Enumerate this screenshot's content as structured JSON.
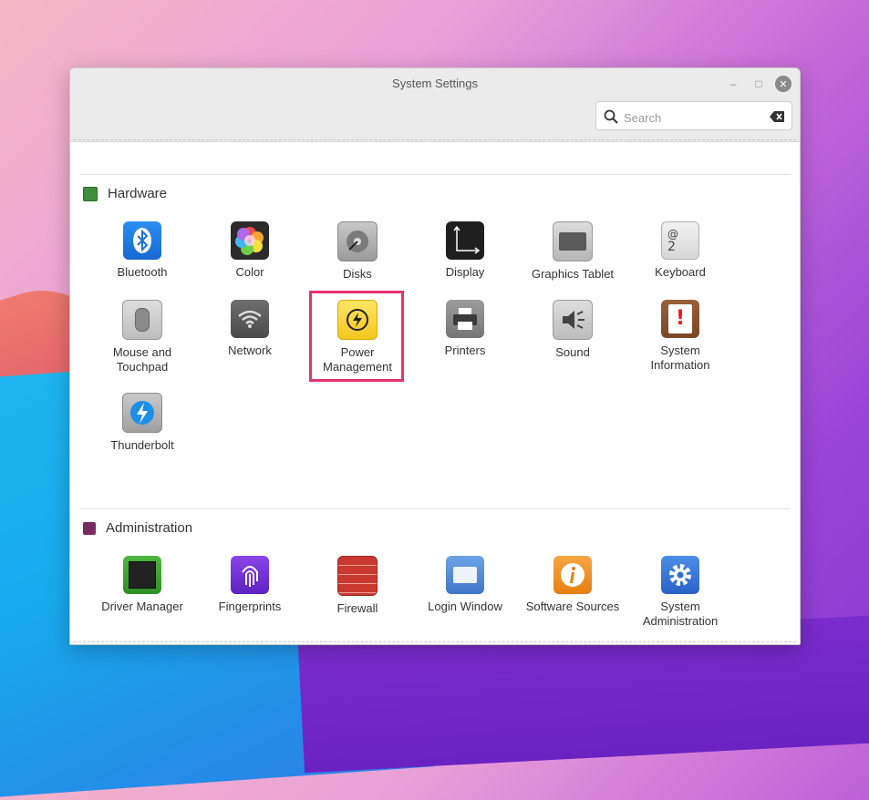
{
  "window": {
    "title": "System Settings"
  },
  "search": {
    "placeholder": "Search",
    "value": ""
  },
  "sections": {
    "hardware": {
      "title": "Hardware",
      "items": [
        {
          "label": "Bluetooth"
        },
        {
          "label": "Color"
        },
        {
          "label": "Disks"
        },
        {
          "label": "Display"
        },
        {
          "label": "Graphics Tablet"
        },
        {
          "label": "Keyboard"
        },
        {
          "label": "Mouse and Touchpad"
        },
        {
          "label": "Network"
        },
        {
          "label": "Power Management"
        },
        {
          "label": "Printers"
        },
        {
          "label": "Sound"
        },
        {
          "label": "System Information"
        },
        {
          "label": "Thunderbolt"
        }
      ]
    },
    "administration": {
      "title": "Administration",
      "items": [
        {
          "label": "Driver Manager"
        },
        {
          "label": "Fingerprints"
        },
        {
          "label": "Firewall"
        },
        {
          "label": "Login Window"
        },
        {
          "label": "Software Sources"
        },
        {
          "label": "System Administration"
        }
      ]
    }
  },
  "icons": {
    "keyboard_glyph_top": "@",
    "keyboard_glyph_bottom": "2"
  },
  "colors": {
    "highlight": "#e8336f",
    "hardware_section_icon": "#3f8f3a",
    "administration_section_icon": "#7a2a63"
  }
}
